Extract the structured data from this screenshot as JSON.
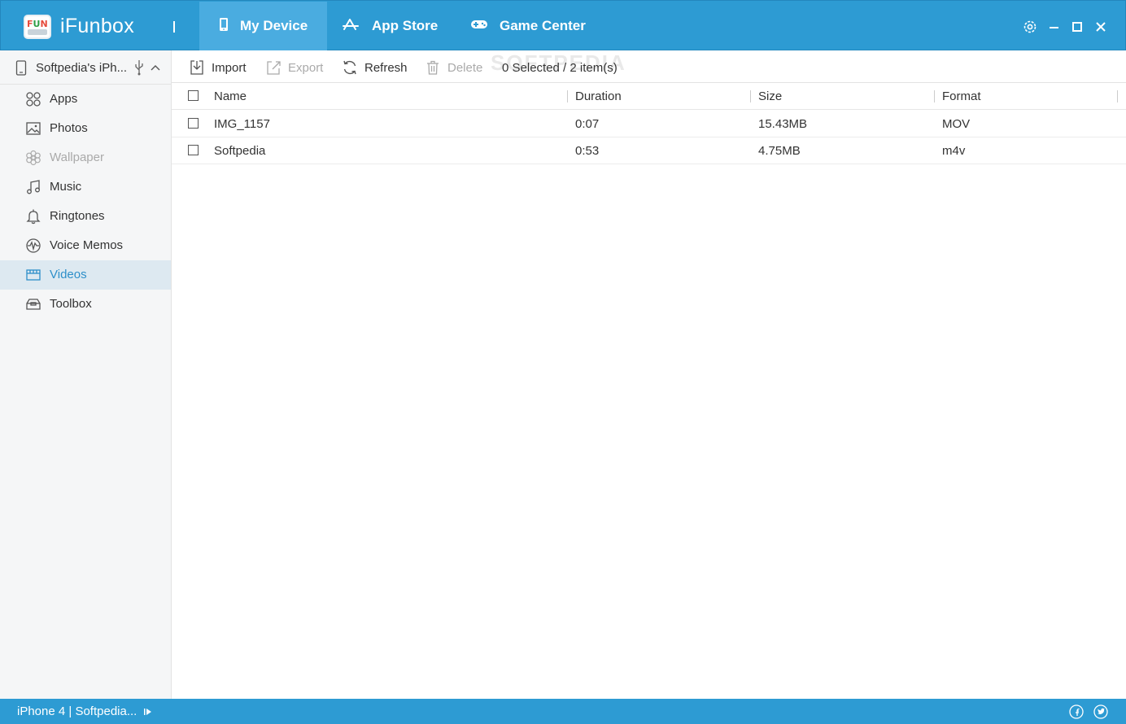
{
  "app": {
    "title": "iFunbox",
    "logo_text": "FUN"
  },
  "nav_tabs": [
    {
      "label": "My Device",
      "active": true
    },
    {
      "label": "App Store",
      "active": false
    },
    {
      "label": "Game Center",
      "active": false
    }
  ],
  "sidebar": {
    "device_name": "Softpedia's iPh...",
    "items": [
      {
        "label": "Apps",
        "icon": "apps-icon"
      },
      {
        "label": "Photos",
        "icon": "photos-icon"
      },
      {
        "label": "Wallpaper",
        "icon": "wallpaper-icon",
        "disabled": true
      },
      {
        "label": "Music",
        "icon": "music-icon"
      },
      {
        "label": "Ringtones",
        "icon": "bell-icon"
      },
      {
        "label": "Voice Memos",
        "icon": "voice-memos-icon"
      },
      {
        "label": "Videos",
        "icon": "videos-icon",
        "active": true
      },
      {
        "label": "Toolbox",
        "icon": "toolbox-icon"
      }
    ]
  },
  "toolbar": {
    "import_label": "Import",
    "export_label": "Export",
    "refresh_label": "Refresh",
    "delete_label": "Delete",
    "selection_count": "0 Selected / 2 item(s)",
    "watermark": "SOFTPEDIA"
  },
  "table": {
    "headers": {
      "name": "Name",
      "duration": "Duration",
      "size": "Size",
      "format": "Format"
    },
    "rows": [
      {
        "name": "IMG_1157",
        "duration": "0:07",
        "size": "15.43MB",
        "format": "MOV"
      },
      {
        "name": "Softpedia",
        "duration": "0:53",
        "size": "4.75MB",
        "format": "m4v"
      }
    ]
  },
  "statusbar": {
    "device": "iPhone 4 | Softpedia..."
  },
  "colors": {
    "accent": "#2d9bd3",
    "active_tab": "#4aace0",
    "sidebar_active": "#dde9f1",
    "link_active": "#2d8fc9"
  }
}
